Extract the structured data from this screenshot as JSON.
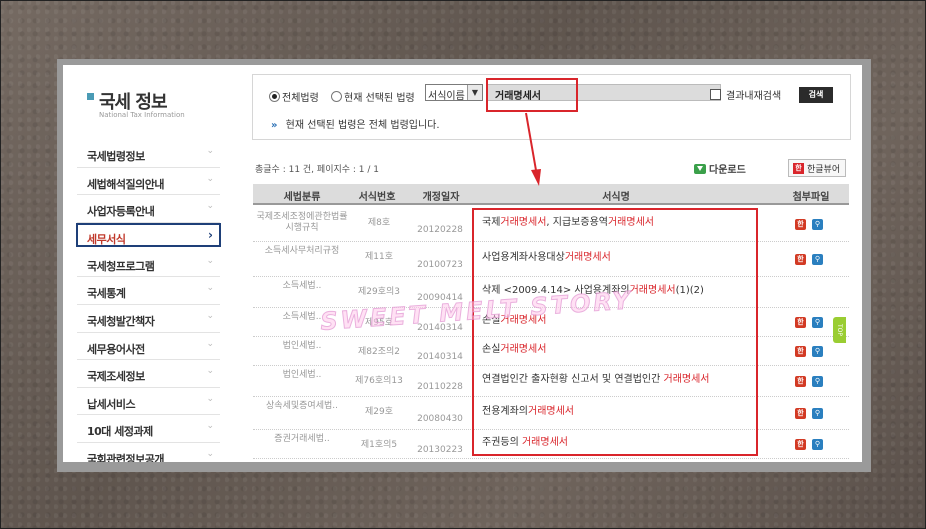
{
  "logo": {
    "title": "국세 정보",
    "subtitle": "National Tax Information"
  },
  "nav": {
    "items": [
      {
        "label": "국세법령정보",
        "active": false
      },
      {
        "label": "세법해석질의안내",
        "active": false
      },
      {
        "label": "사업자등록안내",
        "active": false
      },
      {
        "label": "세무서식",
        "active": true
      },
      {
        "label": "국세청프로그램",
        "active": false
      },
      {
        "label": "국세통계",
        "active": false
      },
      {
        "label": "국세청발간책자",
        "active": false
      },
      {
        "label": "세무용어사전",
        "active": false
      },
      {
        "label": "국제조세정보",
        "active": false
      },
      {
        "label": "납세서비스",
        "active": false
      },
      {
        "label": "10대 세정과제",
        "active": false
      },
      {
        "label": "국회관련정보공개",
        "active": false
      }
    ],
    "chevron": "⌄",
    "active_chevron": "›"
  },
  "search": {
    "radio_all": "전체법령",
    "radio_selected": "현재 선택된 법령",
    "select_value": "서식이름",
    "query": "거래명세서",
    "within_label": "결과내재검색",
    "search_button": "검색",
    "note_mark": "»",
    "note": "현재 선택된 법령은 전체 법령입니다."
  },
  "results": {
    "count_text": "총글수 : 11 건, 페이지수 : 1 / 1",
    "download_label": "다운로드",
    "hangul_viewer": "한글뷰어",
    "columns": [
      "세법분류",
      "서식번호",
      "개정일자",
      "서식명",
      "첨부파일"
    ],
    "rows": [
      {
        "category": "국제조세조정에관한법률 시행규칙",
        "number": "제8호",
        "date": "20120228",
        "name": [
          {
            "t": "국제"
          },
          {
            "t": "거래명세서",
            "hl": true
          },
          {
            "t": ", 지급보증용역"
          },
          {
            "t": "거래명세서",
            "hl": true
          }
        ],
        "files": true
      },
      {
        "category": "소득세사무처리규정",
        "number": "제11호",
        "date": "20100723",
        "name": [
          {
            "t": "사업용계좌사용대상"
          },
          {
            "t": "거래명세서",
            "hl": true
          }
        ],
        "files": true
      },
      {
        "category": "소득세법..",
        "number": "제29호의3",
        "date": "20090414",
        "name": [
          {
            "t": "삭제 <2009.4.14> 사업용계좌의"
          },
          {
            "t": "거래명세서",
            "hl": true
          },
          {
            "t": "(1)(2)"
          }
        ],
        "files": false
      },
      {
        "category": "소득세법..",
        "number": "제95호",
        "date": "20140314",
        "name": [
          {
            "t": "손실"
          },
          {
            "t": "거래명세서",
            "hl": true
          }
        ],
        "files": true
      },
      {
        "category": "법인세법..",
        "number": "제82조의2",
        "date": "20140314",
        "name": [
          {
            "t": "손실"
          },
          {
            "t": "거래명세서",
            "hl": true
          }
        ],
        "files": true
      },
      {
        "category": "법인세법..",
        "number": "제76호의13",
        "date": "20110228",
        "name": [
          {
            "t": "연결법인간 출자현황 신고서 및 연결법인간 "
          },
          {
            "t": "거래명세서",
            "hl": true
          }
        ],
        "files": true
      },
      {
        "category": "상속세및증여세법..",
        "number": "제29호",
        "date": "20080430",
        "name": [
          {
            "t": "전용계좌의"
          },
          {
            "t": "거래명세서",
            "hl": true
          }
        ],
        "files": true
      },
      {
        "category": "증권거래세법..",
        "number": "제1호의5",
        "date": "20130223",
        "name": [
          {
            "t": "주권등의 "
          },
          {
            "t": "거래명세서",
            "hl": true
          }
        ],
        "files": true
      }
    ],
    "file_icons": {
      "hwp": "한",
      "view": "🔍"
    }
  },
  "side_tab": "TOP",
  "watermark": "SWEET MELT STORY",
  "colors": {
    "highlight": "#d9252b",
    "nav_active_border": "#1e3f78",
    "logo_square": "#4a9bb5",
    "hwp_icon": "#d23a24",
    "view_icon": "#2a7fbf",
    "side_tab": "#9acd32"
  }
}
